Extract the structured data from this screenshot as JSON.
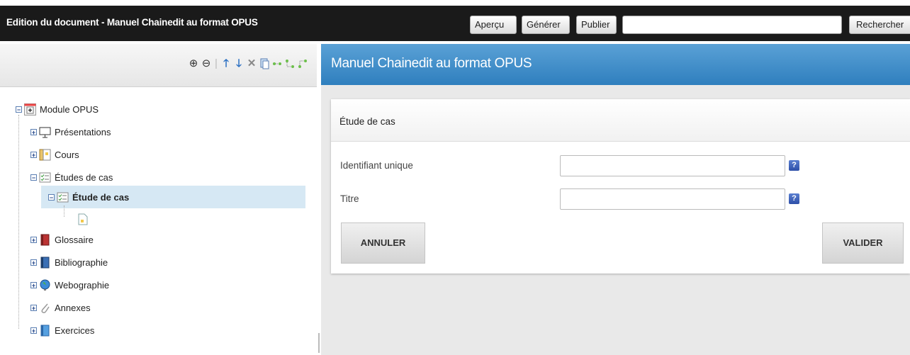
{
  "topbar": {
    "title": "Edition du document - Manuel Chainedit au format OPUS",
    "buttons": {
      "preview": "Aperçu",
      "generate": "Générer",
      "publish": "Publier"
    },
    "search_value": "",
    "search_button": "Rechercher"
  },
  "tree": {
    "root": "Module OPUS",
    "items": [
      {
        "label": "Présentations",
        "icon": "presentation-icon"
      },
      {
        "label": "Cours",
        "icon": "course-icon"
      },
      {
        "label": "Études de cas",
        "icon": "checklist-icon"
      },
      {
        "label": "Étude de cas",
        "icon": "checklist-icon"
      },
      {
        "label": "Glossaire",
        "icon": "book-red-icon"
      },
      {
        "label": "Bibliographie",
        "icon": "book-blue-icon"
      },
      {
        "label": "Webographie",
        "icon": "globe-icon"
      },
      {
        "label": "Annexes",
        "icon": "paperclip-icon"
      },
      {
        "label": "Exercices",
        "icon": "document-blue-icon"
      }
    ]
  },
  "main": {
    "header_title": "Manuel Chainedit au format OPUS",
    "card_title": "Étude de cas",
    "fields": [
      {
        "label": "Identifiant unique",
        "value": ""
      },
      {
        "label": "Titre",
        "value": ""
      }
    ],
    "help_glyph": "?",
    "cancel_label": "ANNULER",
    "validate_label": "VALIDER"
  }
}
